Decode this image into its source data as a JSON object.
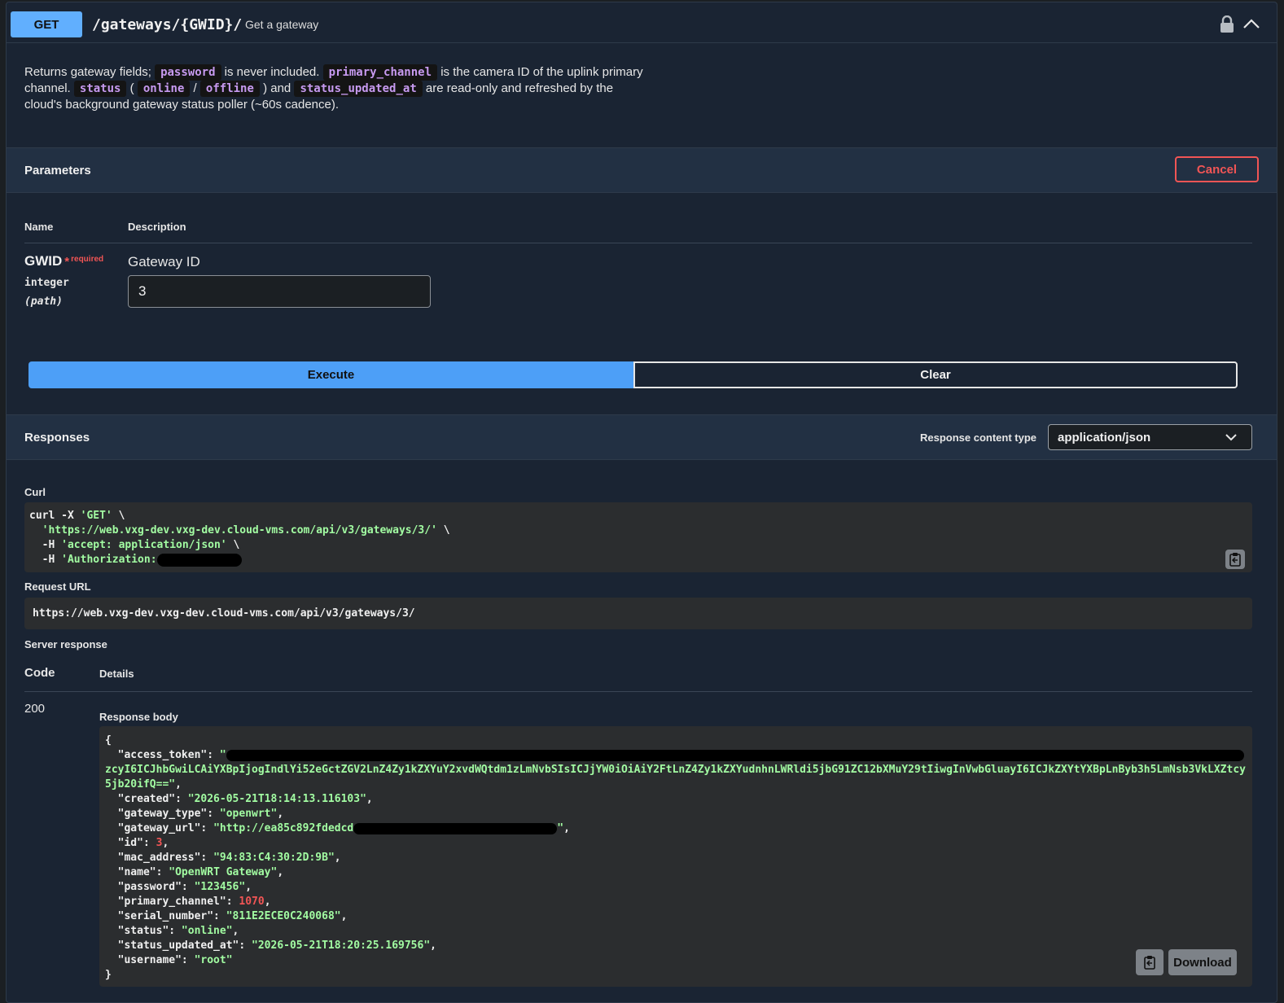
{
  "operation": {
    "method": "GET",
    "path": "/gateways/{GWID}/",
    "summary": "Get a gateway"
  },
  "description": {
    "t1": "Returns gateway fields; ",
    "c1": "password",
    "t2": " is never included. ",
    "c2": "primary_channel",
    "t3": " is the camera ID of the uplink primary channel. ",
    "c3": "status",
    "t4": " ( ",
    "c4": "online",
    "t5": " / ",
    "c5": "offline",
    "t6": " ) and ",
    "c6": "status_updated_at",
    "t7": " are read-only and refreshed by the cloud's background gateway status poller (~60s cadence)."
  },
  "parameters": {
    "title": "Parameters",
    "cancel_label": "Cancel",
    "col_name": "Name",
    "col_description": "Description",
    "param": {
      "name": "GWID",
      "star": "*",
      "required": "required",
      "type": "integer",
      "in": "(path)",
      "description": "Gateway ID",
      "value": "3"
    },
    "execute_label": "Execute",
    "clear_label": "Clear"
  },
  "responses": {
    "title": "Responses",
    "content_type_label": "Response content type",
    "content_type_value": "application/json",
    "curl_label": "Curl",
    "curl": {
      "l1_cmd": "curl -X ",
      "l1_method": "'GET'",
      "l1_end": " \\",
      "l2_url": "'https://web.vxg-dev.vxg-dev.cloud-vms.com/api/v3/gateways/3/'",
      "l2_end": " \\",
      "l3_flag": "-H ",
      "l3_val": "'accept: application/json'",
      "l3_end": " \\",
      "l4_flag": "-H ",
      "l4_val": "'Authorization:"
    },
    "request_url_label": "Request URL",
    "request_url": "https://web.vxg-dev.vxg-dev.cloud-vms.com/api/v3/gateways/3/",
    "server_response_label": "Server response",
    "code_header": "Code",
    "details_header": "Details",
    "code": "200",
    "body_label": "Response body",
    "body": {
      "open": "{",
      "access_token_key": "  \"access_token\": ",
      "access_token_open": "\"",
      "access_token_tail": "zcyI6ICJhbGwiLCAiYXBpIjogIndlYi52eGctZGV2LnZ4Zy1kZXYuY2xvdWQtdm1zLmNvbSIsICJjYW0iOiAiY2FtLnZ4Zy1kZXYudnhnLWRldi5jbG91ZC12bXMuY29tIiwgInVwbGluayI6ICJkZXYtYXBpLnByb3h5LmNsb3VkLXZtcy5jb20ifQ==\"",
      "access_token_end": ",",
      "created_key": "  \"created\": ",
      "created_val": "\"2026-05-21T18:14:13.116103\"",
      "gateway_type_key": "  \"gateway_type\": ",
      "gateway_type_val": "\"openwrt\"",
      "gateway_url_key": "  \"gateway_url\": ",
      "gateway_url_val": "\"http://ea85c892fdedcd",
      "gateway_url_close": "\"",
      "id_key": "  \"id\": ",
      "id_val": "3",
      "mac_key": "  \"mac_address\": ",
      "mac_val": "\"94:83:C4:30:2D:9B\"",
      "name_key": "  \"name\": ",
      "name_val": "\"OpenWRT Gateway\"",
      "password_key": "  \"password\": ",
      "password_val": "\"123456\"",
      "primary_channel_key": "  \"primary_channel\": ",
      "primary_channel_val": "1070",
      "serial_key": "  \"serial_number\": ",
      "serial_val": "\"811E2ECE0C240068\"",
      "status_key": "  \"status\": ",
      "status_val": "\"online\"",
      "status_updated_key": "  \"status_updated_at\": ",
      "status_updated_val": "\"2026-05-21T18:20:25.169756\"",
      "username_key": "  \"username\": ",
      "username_val": "\"root\"",
      "comma": ",",
      "close": "}"
    },
    "download_label": "Download"
  },
  "icons": {
    "lock": "lock-icon",
    "collapse": "chevron-up-icon",
    "dropdown": "chevron-down-icon",
    "copy": "clipboard-copy-icon"
  },
  "colors": {
    "method_get": "#61affe",
    "execute": "#4d9ff7",
    "danger": "#f15555",
    "json_string": "#a2fca2",
    "json_number": "#f15555",
    "inline_code": "#c79af0"
  }
}
